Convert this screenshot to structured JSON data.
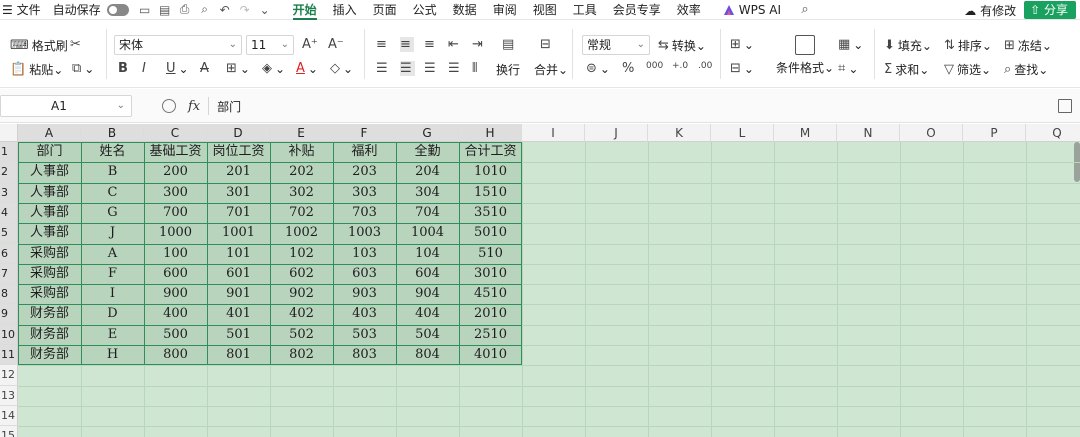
{
  "menu": {
    "file": "文件",
    "autosave": "自动保存",
    "tabs": [
      "开始",
      "插入",
      "页面",
      "公式",
      "数据",
      "审阅",
      "视图",
      "工具",
      "会员专享",
      "效率"
    ],
    "active_tab": "开始",
    "wps_ai": "WPS AI",
    "modified": "有修改",
    "share": "分享"
  },
  "ribbon": {
    "format_painter": "格式刷",
    "paste": "粘贴",
    "font_name": "宋体",
    "font_size": "11",
    "wrap": "换行",
    "merge": "合并",
    "number_format": "常规",
    "convert": "转换",
    "conditional_format": "条件格式",
    "fill": "填充",
    "sort": "排序",
    "freeze": "冻结",
    "sum": "求和",
    "filter": "筛选",
    "find": "查找"
  },
  "formula_bar": {
    "cell_ref": "A1",
    "fx": "fx",
    "value": "部门"
  },
  "sheet": {
    "columns": [
      "A",
      "B",
      "C",
      "D",
      "E",
      "F",
      "G",
      "H",
      "I",
      "J",
      "K",
      "L",
      "M",
      "N",
      "O",
      "P",
      "Q"
    ],
    "row_numbers": [
      "1",
      "2",
      "3",
      "4",
      "5",
      "6",
      "7",
      "8",
      "9",
      "10",
      "11",
      "12",
      "13",
      "14",
      "15"
    ],
    "headers": [
      "部门",
      "姓名",
      "基础工资",
      "岗位工资",
      "补贴",
      "福利",
      "全勤",
      "合计工资"
    ],
    "rows": [
      [
        "人事部",
        "B",
        "200",
        "201",
        "202",
        "203",
        "204",
        "1010"
      ],
      [
        "人事部",
        "C",
        "300",
        "301",
        "302",
        "303",
        "304",
        "1510"
      ],
      [
        "人事部",
        "G",
        "700",
        "701",
        "702",
        "703",
        "704",
        "3510"
      ],
      [
        "人事部",
        "J",
        "1000",
        "1001",
        "1002",
        "1003",
        "1004",
        "5010"
      ],
      [
        "采购部",
        "A",
        "100",
        "101",
        "102",
        "103",
        "104",
        "510"
      ],
      [
        "采购部",
        "F",
        "600",
        "601",
        "602",
        "603",
        "604",
        "3010"
      ],
      [
        "采购部",
        "I",
        "900",
        "901",
        "902",
        "903",
        "904",
        "4510"
      ],
      [
        "财务部",
        "D",
        "400",
        "401",
        "402",
        "403",
        "404",
        "2010"
      ],
      [
        "财务部",
        "E",
        "500",
        "501",
        "502",
        "503",
        "504",
        "2510"
      ],
      [
        "财务部",
        "H",
        "800",
        "801",
        "802",
        "803",
        "804",
        "4010"
      ]
    ]
  }
}
